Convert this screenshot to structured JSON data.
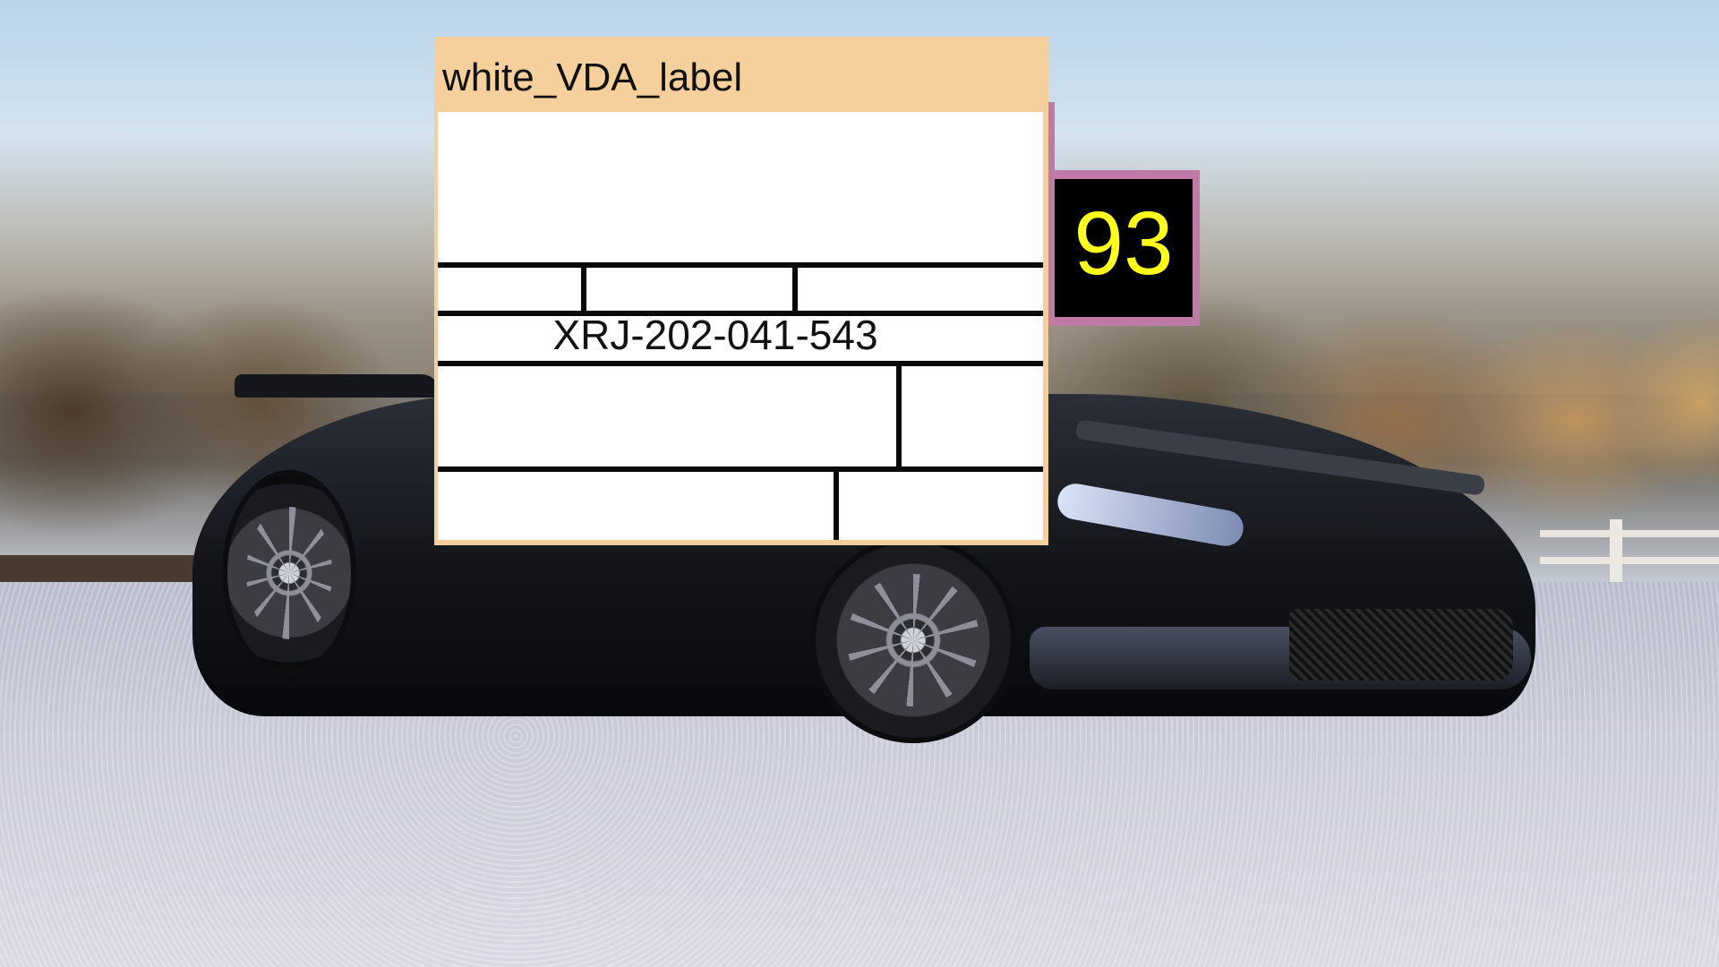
{
  "label": {
    "title": "white_VDA_label",
    "id_code": "XRJ-202-041-543",
    "header_color": "#f5cf9c"
  },
  "badge": {
    "value": "93",
    "border_color": "#c07aa8",
    "text_color": "#ffff1a"
  },
  "background": {
    "scene": "black supercar parked on gravel with autumn trees and white fence"
  }
}
